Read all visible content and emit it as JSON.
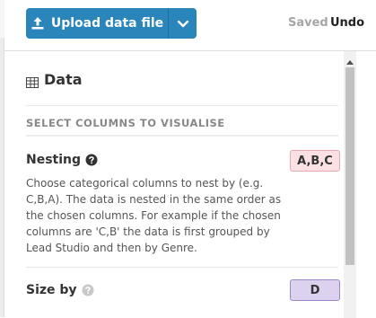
{
  "toolbar": {
    "upload_label": "Upload data file",
    "saved_label": "Saved",
    "undo_label": "Undo"
  },
  "panel": {
    "title": "Data",
    "section_title": "SELECT COLUMNS TO VISUALISE",
    "nesting": {
      "label": "Nesting",
      "description": "Choose categorical columns to nest by (e.g. C,B,A). The data is nested in the same order as the chosen columns. For example if the chosen columns are 'C,B' the data is first grouped by Lead Studio and then by Genre.",
      "value": "A,B,C"
    },
    "size_by": {
      "label": "Size by",
      "value": "D"
    }
  },
  "colors": {
    "accent": "#2a86ba",
    "nesting_chip_bg": "#fbe0e4",
    "nesting_chip_border": "#e7a8b3",
    "size_chip_bg": "#dcd2ef",
    "size_chip_border": "#9a88c8"
  },
  "icons": {
    "upload": "upload-icon",
    "dropdown": "chevron-down-icon",
    "table": "table-icon",
    "help": "help-icon",
    "scroll_up": "arrow-up-icon"
  }
}
